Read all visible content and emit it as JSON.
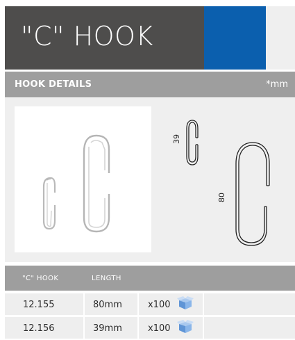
{
  "header": {
    "title": "\"C\" HOOK"
  },
  "details": {
    "title": "HOOK DETAILS",
    "unit": "*mm"
  },
  "drawings": {
    "small_dimension": "39",
    "large_dimension": "80"
  },
  "table": {
    "columns": [
      "\"C\" HOOK",
      "LENGTH"
    ],
    "rows": [
      {
        "code": "12.155",
        "length": "80mm",
        "quantity": "x100",
        "icon": "box-icon"
      },
      {
        "code": "12.156",
        "length": "39mm",
        "quantity": "x100",
        "icon": "box-icon"
      }
    ]
  },
  "colors": {
    "header_bg": "#4e4d4c",
    "accent": "#0b5fae",
    "section_bar": "#9e9e9e",
    "panel_bg": "#efefef"
  }
}
